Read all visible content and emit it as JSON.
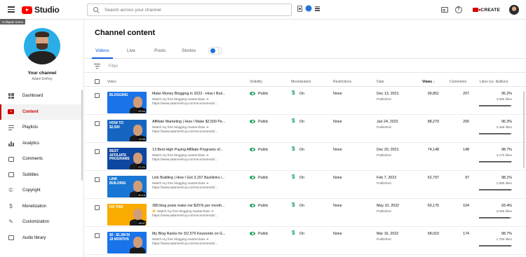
{
  "app": {
    "logo_text": "Studio",
    "tooltip": "Collapse menu",
    "search_placeholder": "Search across your channel",
    "create_label": "CREATE"
  },
  "sidebar": {
    "your_channel": "Your channel",
    "channel_name": "Adam Enfroy",
    "items": [
      {
        "label": "Dashboard",
        "icon": "dashboard-icon"
      },
      {
        "label": "Content",
        "icon": "content-icon",
        "active": true
      },
      {
        "label": "Playlists",
        "icon": "playlists-icon"
      },
      {
        "label": "Analytics",
        "icon": "analytics-icon"
      },
      {
        "label": "Comments",
        "icon": "comments-icon"
      },
      {
        "label": "Subtitles",
        "icon": "subtitles-icon"
      },
      {
        "label": "Copyright",
        "icon": "copyright-icon"
      },
      {
        "label": "Monetization",
        "icon": "monetization-icon"
      },
      {
        "label": "Customization",
        "icon": "customization-icon"
      },
      {
        "label": "Audio library",
        "icon": "audio-library-icon"
      }
    ]
  },
  "main": {
    "title": "Channel content",
    "tabs": [
      "Videos",
      "Live",
      "Posts",
      "Stories"
    ],
    "filter_label": "Filter",
    "columns": {
      "video": "Video",
      "visibility": "Visibility",
      "monetization": "Monetization",
      "restrictions": "Restrictions",
      "date": "Date",
      "views": "Views",
      "comments": "Comments",
      "likes": "Likes (vs. dislikes)"
    },
    "rows": [
      {
        "title": "Make Money Blogging in 2022 - How I Buil...",
        "desc1": "Watch my free blogging masterclass ➔",
        "desc2": "https://www.adamenfroy.com/recommends/...",
        "thumb_text": "BLOGGING",
        "thumb_bg": "#1a73e8",
        "duration": "25:54",
        "visibility": "Public",
        "monetization": "On",
        "restrictions": "None",
        "date": "Dec 13, 2021",
        "status": "Published",
        "views": "99,851",
        "comments": "207",
        "likes_pct": "95.2%",
        "likes_count": "4,596 likes",
        "likes_ratio": 0.952
      },
      {
        "title": "Affiliate Marketing | How I Make $2,500 Pe...",
        "desc1": "Watch my free blogging masterclass ➔",
        "desc2": "https://www.adamenfroy.com/recommends/...",
        "thumb_text": "HOW TO $2,500",
        "thumb_bg": "#1565c0",
        "duration": "12:56",
        "visibility": "Public",
        "monetization": "On",
        "restrictions": "None",
        "date": "Jan 24, 2022",
        "status": "Published",
        "views": "88,279",
        "comments": "200",
        "likes_pct": "96.3%",
        "likes_count": "3,466 likes",
        "likes_ratio": 0.963
      },
      {
        "title": "13 Best High Paying Affiliate Programs of...",
        "desc1": "Watch my free blogging masterclass ➔",
        "desc2": "https://www.adamenfroy.com/recommends/...",
        "thumb_text": "BEST AFFILIATE PROGRAMS",
        "thumb_bg": "#0d47a1",
        "duration": "27:21",
        "visibility": "Public",
        "monetization": "On",
        "restrictions": "None",
        "date": "Dec 20, 2021",
        "status": "Published",
        "views": "74,148",
        "comments": "148",
        "likes_pct": "98.7%",
        "likes_count": "3,270 likes",
        "likes_ratio": 0.987
      },
      {
        "title": "Link Building | How I Got 3,157 Backlinks i...",
        "desc1": "Watch my free blogging masterclass ➔",
        "desc2": "https://www.adamenfroy.com/recommends/...",
        "thumb_text": "LINK BUILDING",
        "thumb_bg": "#1976d2",
        "duration": "30:16",
        "visibility": "Public",
        "monetization": "On",
        "restrictions": "None",
        "date": "Feb 7, 2022",
        "status": "Published",
        "views": "62,797",
        "comments": "97",
        "likes_pct": "98.1%",
        "likes_count": "1,995 likes",
        "likes_ratio": 0.981
      },
      {
        "title": "389 blog posts make me $207k per month...",
        "desc1": "👉 Watch my free blogging masterclass ➔",
        "desc2": "https://www.adamenfroy.com/recommends/...",
        "thumb_text": "DO THIS",
        "thumb_bg": "#f9ab00",
        "duration": "18:57",
        "visibility": "Public",
        "monetization": "On",
        "restrictions": "None",
        "date": "May 10, 2022",
        "status": "Published",
        "views": "60,175",
        "comments": "104",
        "likes_pct": "93.4%",
        "likes_count": "2,096 likes",
        "likes_ratio": 0.934
      },
      {
        "title": "My Blog Ranks for 3/2,579 Keywords on G...",
        "desc1": "Watch my free blogging masterclass ➔",
        "desc2": "https://www.adamenfroy.com/recommends/...",
        "thumb_text": "$0 - $1.3M IN 18 MONTHS",
        "thumb_bg": "#1a73e8",
        "duration": "",
        "visibility": "Public",
        "monetization": "On",
        "restrictions": "None",
        "date": "Mar 16, 2022",
        "status": "Published",
        "views": "58,010",
        "comments": "174",
        "likes_pct": "98.7%",
        "likes_count": "1,780 likes",
        "likes_ratio": 0.987
      }
    ]
  },
  "colors": {
    "accent_red": "#cc0000",
    "tab_blue": "#065fd4",
    "status_green": "#0f9d58"
  }
}
